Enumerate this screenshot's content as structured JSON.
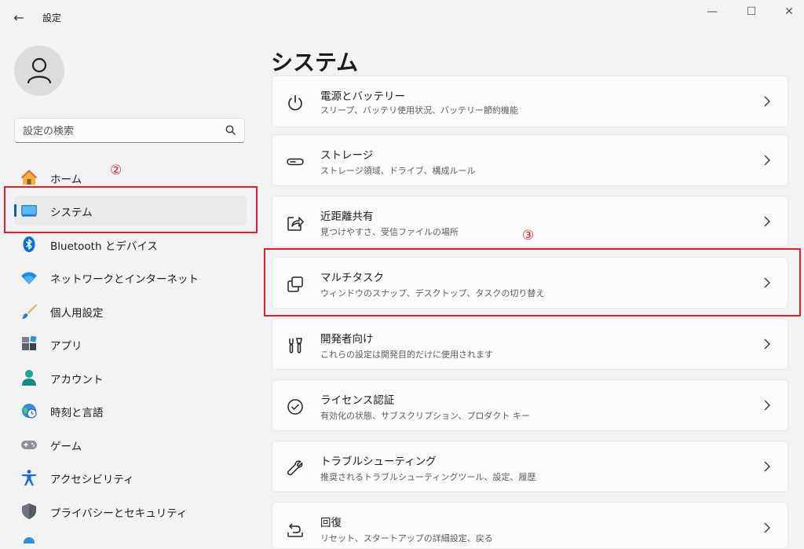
{
  "window": {
    "title": "設定",
    "back_icon": "←",
    "minimize_icon": "—",
    "maximize_icon": "☐",
    "close_icon": "✕"
  },
  "search": {
    "placeholder": "設定の検索"
  },
  "sidebar": {
    "items": [
      {
        "label": "ホーム",
        "icon": "home-icon"
      },
      {
        "label": "システム",
        "icon": "system-icon",
        "active": true
      },
      {
        "label": "Bluetooth とデバイス",
        "icon": "bluetooth-icon"
      },
      {
        "label": "ネットワークとインターネット",
        "icon": "wifi-icon"
      },
      {
        "label": "個人用設定",
        "icon": "brush-icon"
      },
      {
        "label": "アプリ",
        "icon": "apps-icon"
      },
      {
        "label": "アカウント",
        "icon": "account-icon"
      },
      {
        "label": "時刻と言語",
        "icon": "clock-globe-icon"
      },
      {
        "label": "ゲーム",
        "icon": "gamepad-icon"
      },
      {
        "label": "アクセシビリティ",
        "icon": "accessibility-icon"
      },
      {
        "label": "プライバシーとセキュリティ",
        "icon": "shield-icon"
      }
    ]
  },
  "main": {
    "title": "システム",
    "cards": [
      {
        "title": "電源とバッテリー",
        "subtitle": "スリープ、バッテリ使用状況、バッテリー節約機能",
        "icon": "power-icon"
      },
      {
        "title": "ストレージ",
        "subtitle": "ストレージ領域、ドライブ、構成ルール",
        "icon": "storage-icon"
      },
      {
        "title": "近距離共有",
        "subtitle": "見つけやすさ、受信ファイルの場所",
        "icon": "share-icon"
      },
      {
        "title": "マルチタスク",
        "subtitle": "ウィンドウのスナップ、デスクトップ、タスクの切り替え",
        "icon": "multitask-icon"
      },
      {
        "title": "開発者向け",
        "subtitle": "これらの設定は開発目的だけに使用されます",
        "icon": "developer-tools-icon"
      },
      {
        "title": "ライセンス認証",
        "subtitle": "有効化の状態、サブスクリプション、プロダクト キー",
        "icon": "checkmark-circle-icon"
      },
      {
        "title": "トラブルシューティング",
        "subtitle": "推奨されるトラブルシューティングツール、設定、履歴",
        "icon": "wrench-icon"
      },
      {
        "title": "回復",
        "subtitle": "リセット、スタートアップの詳細設定、戻る",
        "icon": "recovery-icon"
      }
    ]
  },
  "annotations": {
    "marker_2": "②",
    "marker_3": "③"
  },
  "colors": {
    "accent": "#005fb8",
    "annotation": "#e0202a"
  }
}
